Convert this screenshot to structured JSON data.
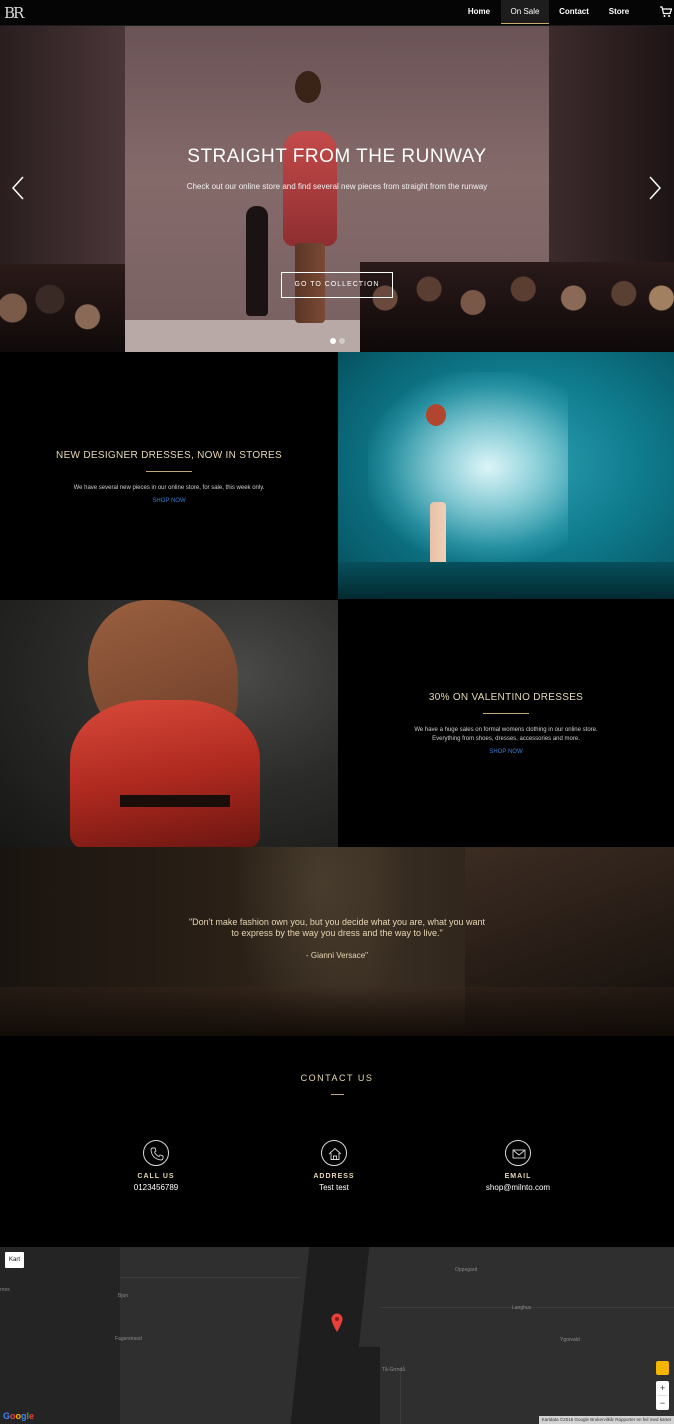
{
  "nav": {
    "logo": "BR",
    "items": [
      {
        "label": "Home"
      },
      {
        "label": "On Sale"
      },
      {
        "label": "Contact"
      },
      {
        "label": "Store"
      }
    ],
    "active_index": 1
  },
  "hero": {
    "title": "STRAIGHT FROM THE RUNWAY",
    "subtitle": "Check out our online store and find several new pieces from straight from the runway",
    "button_label": "GO TO COLLECTION",
    "slides_count": 2,
    "active_slide": 0
  },
  "promo1": {
    "title": "NEW DESIGNER DRESSES, NOW IN STORES",
    "description": "We have several new pieces in our online store, for sale, this week only.",
    "link_label": "SHOP NOW"
  },
  "promo2": {
    "title": "30% ON VALENTINO DRESSES",
    "description_line1": "We have a huge sales on formal womens clothing in our online store.",
    "description_line2": "Everything from shoes, dresses, accessories and more.",
    "link_label": "SHOP NOW"
  },
  "quote": {
    "text": "\"Don't make fashion own you, but you decide what you are, what you want to express by the way you dress and the way to live.\"",
    "author": "- Gianni Versace\""
  },
  "contact": {
    "title": "CONTACT US",
    "items": [
      {
        "label": "CALL US",
        "value": "0123456789",
        "icon": "phone-icon"
      },
      {
        "label": "ADDRESS",
        "value": "Test test",
        "icon": "home-icon"
      },
      {
        "label": "EMAIL",
        "value": "shop@milnto.com",
        "icon": "envelope-icon"
      }
    ]
  },
  "map": {
    "type_button": "Kart",
    "zoom_in": "+",
    "zoom_out": "−",
    "google_logo": "Google",
    "footer_text": "Kartdata ©2016 Google   Brukervilkår   Rapporter en feil med kartet",
    "labels": [
      {
        "text": "Oppegard"
      },
      {
        "text": "Langhus"
      },
      {
        "text": "Fagerstrand"
      },
      {
        "text": "Ygorvald"
      },
      {
        "text": "Bjon"
      },
      {
        "text": "Tå-Grrndå"
      },
      {
        "text": "rnes"
      }
    ]
  },
  "colors": {
    "accent_gold": "#e8d7b4",
    "link_blue": "#3a7fd4",
    "background": "#000000",
    "map_pin": "#e8403a"
  }
}
